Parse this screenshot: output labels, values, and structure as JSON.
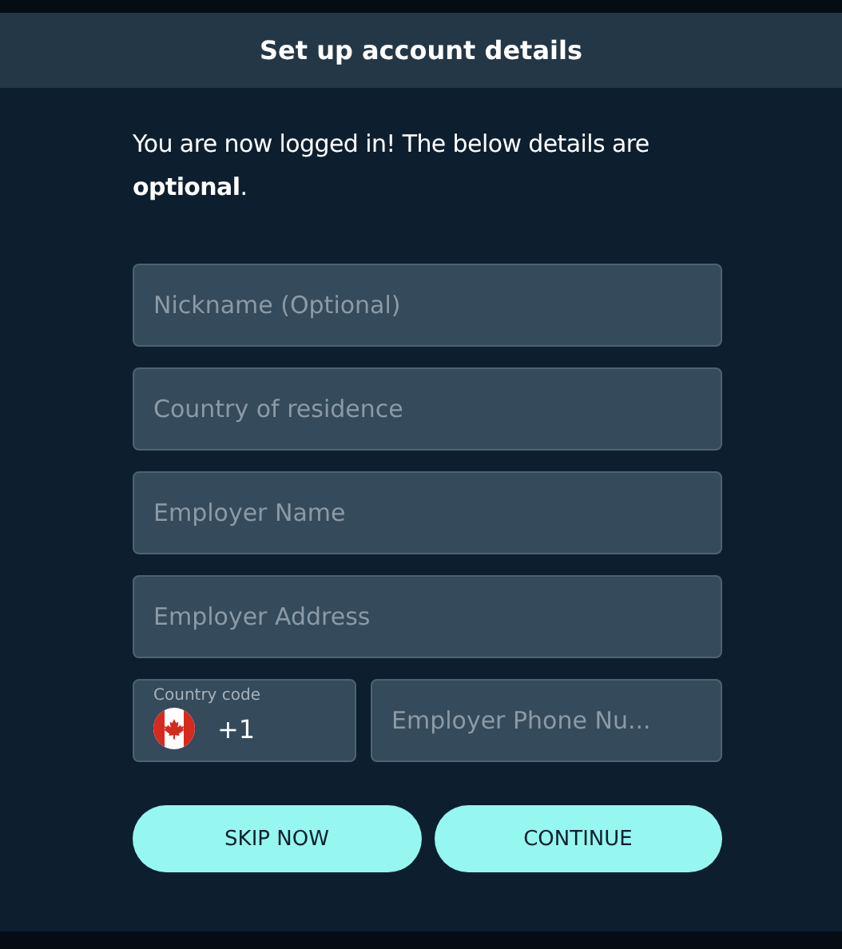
{
  "dialog": {
    "title": "Set up account details"
  },
  "intro": "You are now logged in! The below details are **optional**.",
  "fields": [
    {
      "kind": "text",
      "placeholder": "Nickname (Optional)"
    },
    {
      "kind": "text",
      "placeholder": "Country of residence"
    },
    {
      "kind": "text",
      "placeholder": "Employer Name"
    },
    {
      "kind": "text",
      "placeholder": "Employer Address"
    }
  ],
  "phone": {
    "country_code": {
      "label": "Country code",
      "value": "+1"
    },
    "number": {
      "placeholder": "Employer Phone Nu..."
    }
  },
  "buttons": [
    {
      "label": "SKIP NOW"
    },
    {
      "label": "CONTINUE"
    }
  ]
}
